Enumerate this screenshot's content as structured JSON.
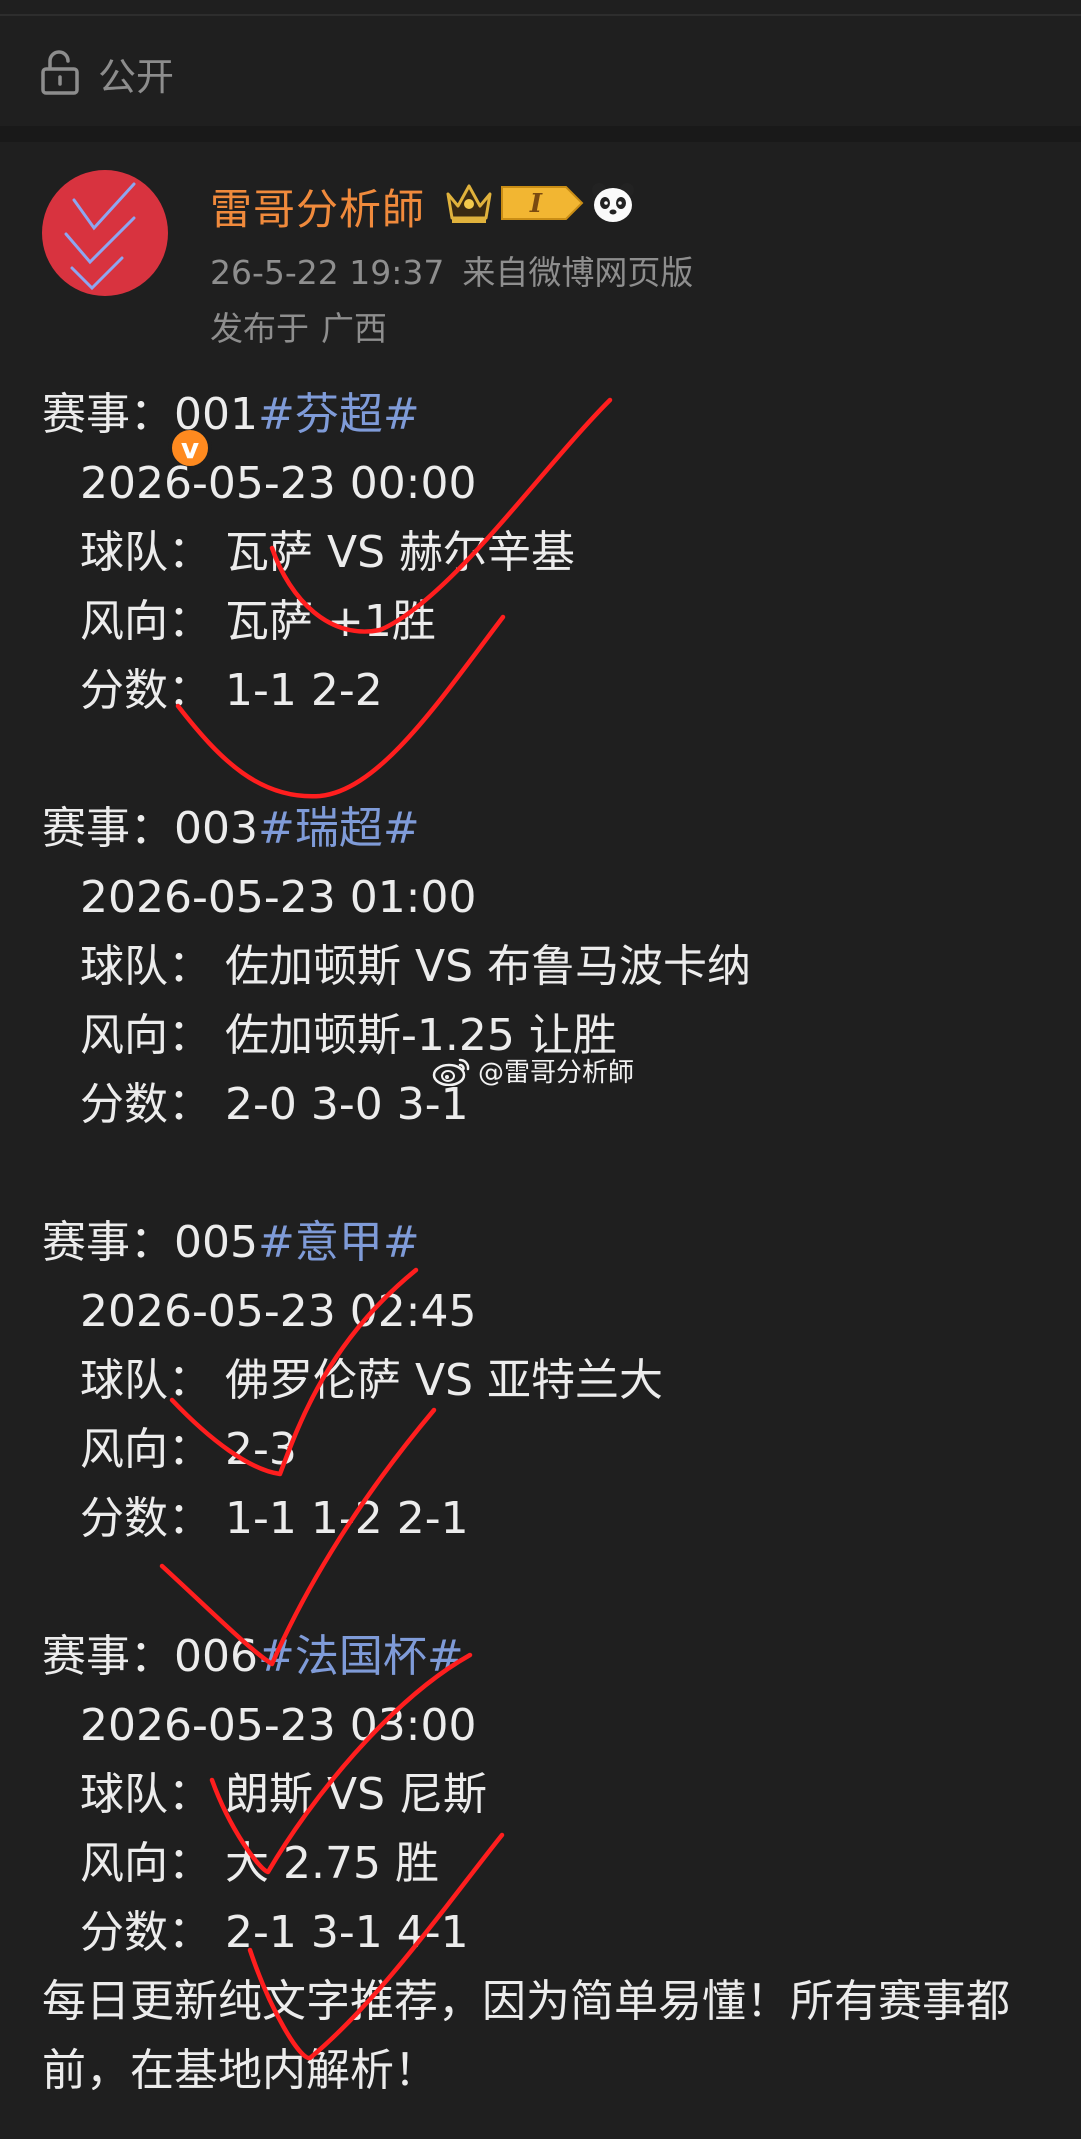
{
  "visibility": {
    "icon": "lock-open-icon",
    "label": "公开"
  },
  "header": {
    "username": "雷哥分析師",
    "badge_level": "I",
    "time_and_source": "26-5-22 19:37",
    "source": "来自微博网页版",
    "location_prefix": "发布于",
    "location": "广西",
    "verified_mark": "v",
    "accent_color": "#f08a3c"
  },
  "matches": [
    {
      "label": "赛事：",
      "code": "001",
      "tag": "#芬超#",
      "datetime": "2026-05-23 00:00",
      "team_label": "球队：",
      "teams": "瓦萨 VS 赫尔辛基",
      "pick_label": "风向：",
      "pick": "瓦萨 +1胜",
      "score_label": "分数：",
      "scores": "1-1 2-2"
    },
    {
      "label": "赛事：",
      "code": "003",
      "tag": "#瑞超#",
      "datetime": "2026-05-23 01:00",
      "team_label": "球队：",
      "teams": "佐加顿斯 VS 布鲁马波卡纳",
      "pick_label": "风向：",
      "pick": "佐加顿斯-1.25 让胜",
      "score_label": "分数：",
      "scores": "2-0 3-0 3-1"
    },
    {
      "label": "赛事：",
      "code": "005",
      "tag": "#意甲#",
      "datetime": "2026-05-23 02:45",
      "team_label": "球队：",
      "teams": "佛罗伦萨 VS 亚特兰大",
      "pick_label": "风向：",
      "pick": "2-3",
      "score_label": "分数：",
      "scores": "1-1 1-2 2-1"
    },
    {
      "label": "赛事：",
      "code": "006",
      "tag": "#法国杯#",
      "datetime": "2026-05-23 03:00",
      "team_label": "球队：",
      "teams": "朗斯 VS 尼斯",
      "pick_label": "风向：",
      "pick": "大 2.75 胜",
      "score_label": "分数：",
      "scores": "2-1 3-1 4-1"
    }
  ],
  "footer": {
    "line1": "每日更新纯文字推荐，因为简单易懂！所有赛事都",
    "line2": "前，在基地内解析！"
  },
  "watermark": {
    "icon": "weibo-icon",
    "text": "@雷哥分析師"
  },
  "colors": {
    "background": "#1f1f1f",
    "hashtag": "#7f9bd8",
    "marker": "#ff1e1e"
  }
}
